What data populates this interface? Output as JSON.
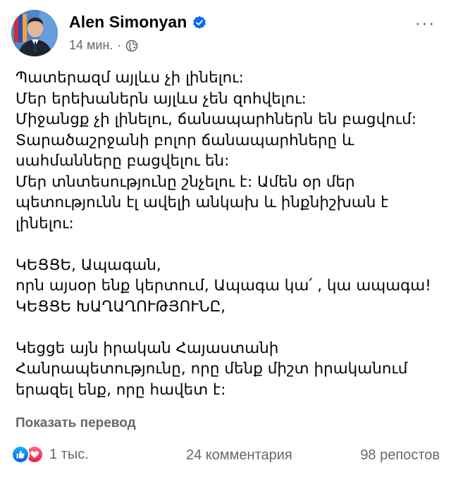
{
  "post": {
    "author": "Alen Simonyan",
    "verified": true,
    "time": "14 мин.",
    "separator": "·",
    "privacy_icon": "globe-icon",
    "more_label": "···",
    "paragraphs": [
      "Պատերազմ այլևս չի լինելու:\nՄեր երեխաներն այլևս չեն զոհվելու:\nՄիջանցք չի լինելու, ճանապարհներն են բացվում:\nՏարածաշրջանի բոլոր ճանապարհները և սահմանները բացվելու են:\nՄեր տնտեսությունը շնչելու է: Ամեն օր մեր պետությունն էլ ավելի անկախ և ինքնիշխան է լինելու:",
      "ԿԵՑՑԵ, Ապագան,\nորն այսօր ենք կերտում, Ապագա կա՛ , կա ապագա!\nԿԵՑՑԵ ԽԱՂԱՂՈՒԹՅՈՒՆԸ,",
      "Կեցցե այն իրական Հայաստանի Հանրապետությունը, որը մենք միշտ իրականում երազել ենք, որը հավետ է:"
    ],
    "translate_label": "Показать перевод"
  },
  "footer": {
    "reactions": [
      "like-icon",
      "love-icon"
    ],
    "reactions_count": "1 тыс.",
    "comments": "24 комментария",
    "shares": "98 репостов"
  },
  "colors": {
    "text": "#050505",
    "secondary": "#65676b",
    "verified": "#0866ff",
    "like": "#0866ff",
    "love": "#f33e58"
  }
}
